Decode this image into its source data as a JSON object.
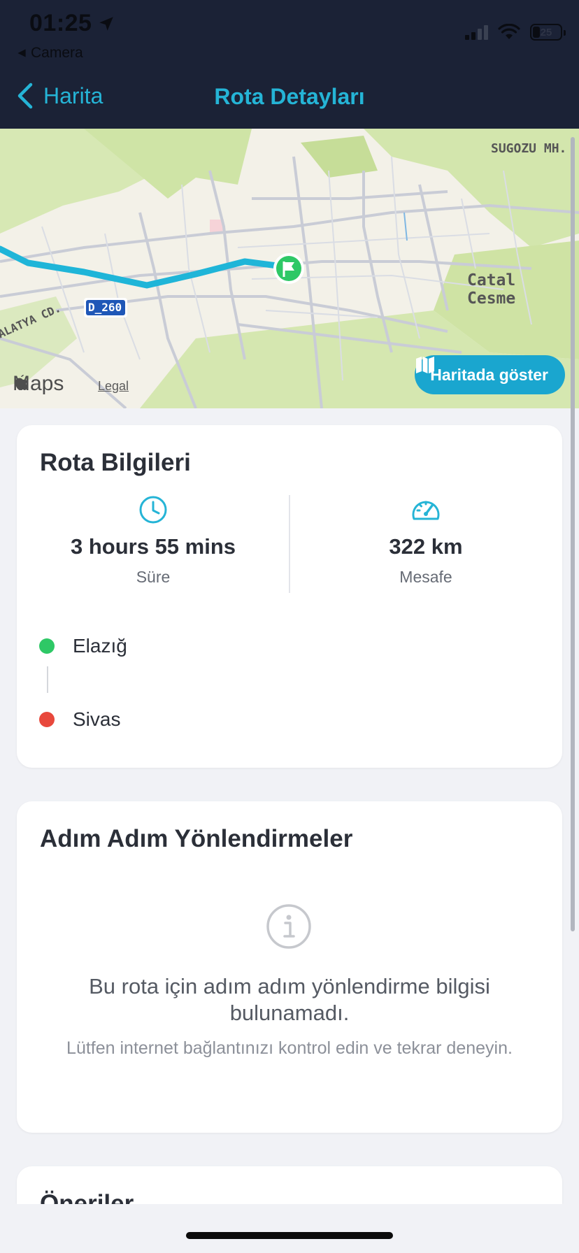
{
  "status_bar": {
    "time": "01:25",
    "back_app": "Camera",
    "battery": "25"
  },
  "nav": {
    "back_label": "Harita",
    "title": "Rota Detayları"
  },
  "map": {
    "labels": {
      "district_1": "SUGOZU MH.",
      "district_2_line1": "Catal",
      "district_2_line2": "Cesme",
      "road_shield": "D_260",
      "street": "ALATYA CD."
    },
    "provider": "Maps",
    "legal": "Legal",
    "show_button": "Haritada göster",
    "route_color": "#1fb5d8",
    "marker_color": "#2ec866"
  },
  "route_info": {
    "title": "Rota Bilgileri",
    "duration": {
      "value": "3 hours 55 mins",
      "label": "Süre"
    },
    "distance": {
      "value": "322 km",
      "label": "Mesafe"
    },
    "origin": {
      "name": "Elazığ",
      "color": "#2ec866"
    },
    "destination": {
      "name": "Sivas",
      "color": "#e8483c"
    }
  },
  "directions": {
    "title": "Adım Adım Yönlendirmeler",
    "empty_message": "Bu rota için adım adım yönlendirme bilgisi bulunamadı.",
    "empty_hint": "Lütfen internet bağlantınızı kontrol edin ve tekrar deneyin."
  },
  "suggestions": {
    "title": "Öneriler"
  },
  "colors": {
    "accent": "#25b4d6",
    "header_bg": "#1b2236",
    "page_bg": "#f1f2f6"
  }
}
